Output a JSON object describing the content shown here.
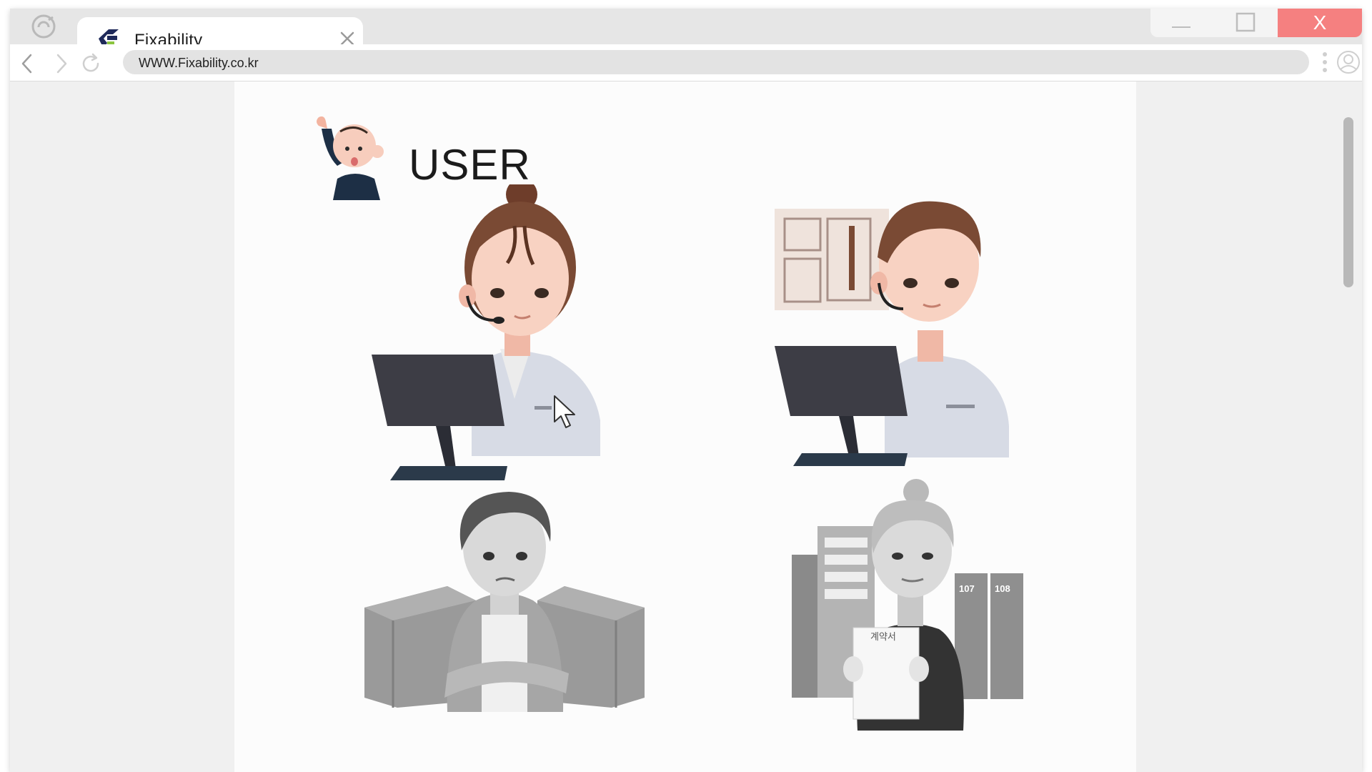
{
  "browser": {
    "tab_title": "Fixability",
    "url": "WWW.Fixability.co.kr",
    "close_label": "X",
    "icons": [
      "browser-logo-icon",
      "fixability-favicon-icon",
      "close-icon",
      "minimize-icon",
      "maximize-icon",
      "back-icon",
      "forward-icon",
      "reload-icon",
      "menu-dots-icon",
      "profile-icon"
    ]
  },
  "page": {
    "heading": "USER",
    "illustrations": [
      {
        "name": "support-agent-woman"
      },
      {
        "name": "support-agent-man"
      },
      {
        "name": "man-with-boxes"
      },
      {
        "name": "elderly-woman-with-contract",
        "contract_label": "계약서",
        "locker_labels": [
          "107",
          "108"
        ]
      }
    ]
  },
  "colors": {
    "close_button": "#f58080",
    "monitor": "#3d3d45",
    "skin": "#f6cbb8",
    "hair": "#7a4a34",
    "brand_navy": "#1f2a5a",
    "brand_green": "#8bc53f"
  }
}
